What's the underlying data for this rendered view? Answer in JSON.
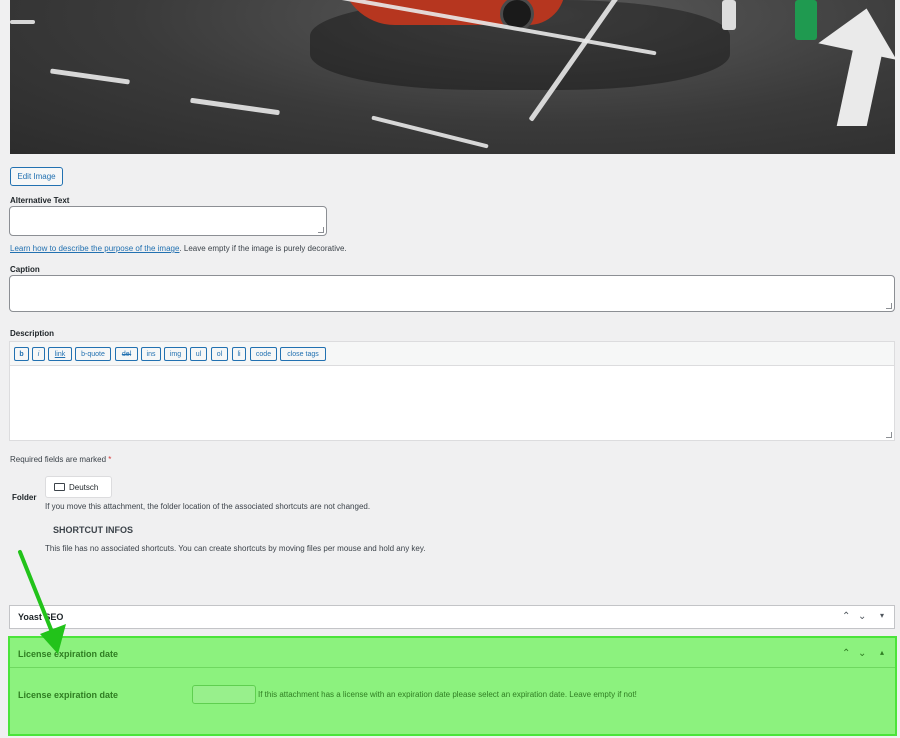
{
  "edit_image_label": "Edit Image",
  "alt_text": {
    "label": "Alternative Text",
    "value": "",
    "help_link": "Learn how to describe the purpose of the image",
    "help_rest": ". Leave empty if the image is purely decorative."
  },
  "caption": {
    "label": "Caption",
    "value": ""
  },
  "description": {
    "label": "Description",
    "value": "",
    "toolbar": [
      "b",
      "i",
      "link",
      "b-quote",
      "del",
      "ins",
      "img",
      "ul",
      "ol",
      "li",
      "code",
      "close tags"
    ]
  },
  "required": {
    "text": "Required fields are marked ",
    "star": "*"
  },
  "folder": {
    "label": "Folder",
    "button": "Deutsch",
    "note": "If you move this attachment, the folder location of the associated shortcuts are not changed."
  },
  "shortcut": {
    "heading": "SHORTCUT INFOS",
    "text": "This file has no associated shortcuts. You can create shortcuts by moving files per mouse and hold any key."
  },
  "yoast": {
    "title": "Yoast SEO"
  },
  "license": {
    "box_title": "License expiration date",
    "field_label": "License expiration date",
    "value": "",
    "help": "If this attachment has a license with an expiration date please select an expiration date. Leave empty if not!"
  },
  "colors": {
    "accent": "#2271b1",
    "highlight": "#8cf27e",
    "annotation_arrow": "#22c31a"
  }
}
